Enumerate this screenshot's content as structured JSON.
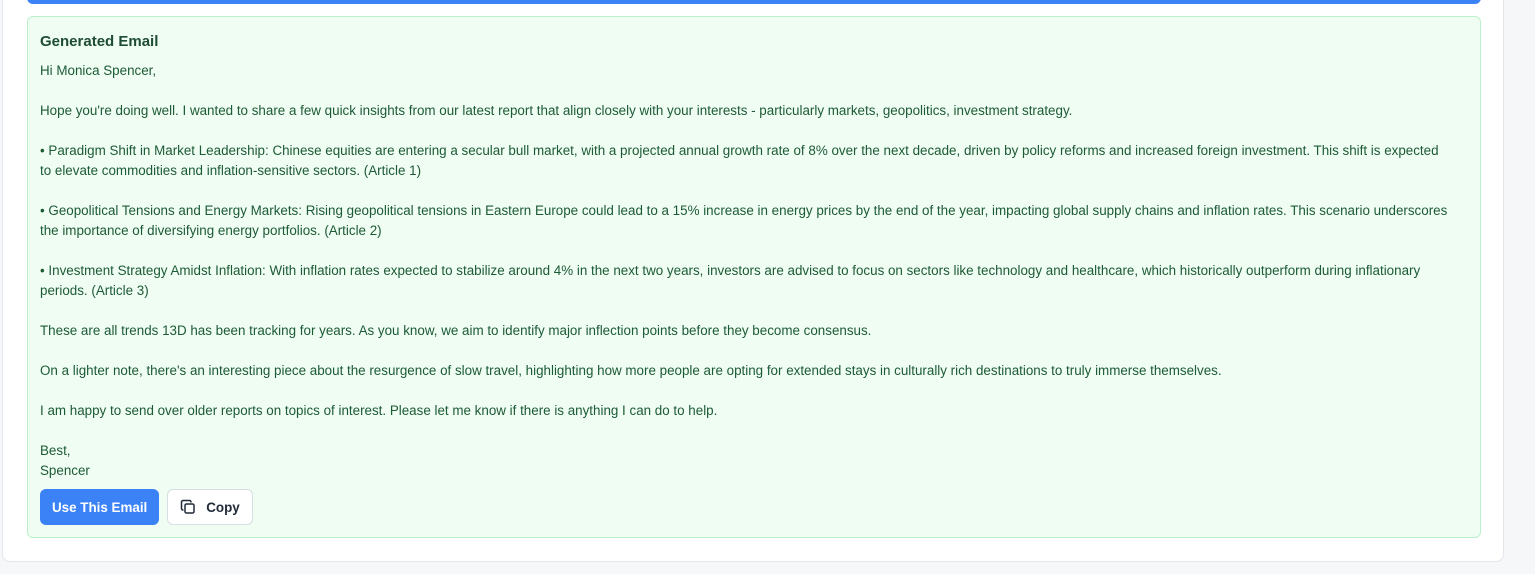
{
  "panel": {
    "title": "Generated Email",
    "paragraphs": [
      "Hi Monica Spencer,",
      "Hope you're doing well. I wanted to share a few quick insights from our latest report that align closely with your interests - particularly markets, geopolitics, investment strategy.",
      "• Paradigm Shift in Market Leadership: Chinese equities are entering a secular bull market, with a projected annual growth rate of 8% over the next decade, driven by policy reforms and increased foreign investment. This shift is expected to elevate commodities and inflation-sensitive sectors. (Article 1)",
      "• Geopolitical Tensions and Energy Markets: Rising geopolitical tensions in Eastern Europe could lead to a 15% increase in energy prices by the end of the year, impacting global supply chains and inflation rates. This scenario underscores the importance of diversifying energy portfolios. (Article 2)",
      "• Investment Strategy Amidst Inflation: With inflation rates expected to stabilize around 4% in the next two years, investors are advised to focus on sectors like technology and healthcare, which historically outperform during inflationary periods. (Article 3)",
      "These are all trends 13D has been tracking for years. As you know, we aim to identify major inflection points before they become consensus.",
      "On a lighter note, there's an interesting piece about the resurgence of slow travel, highlighting how more people are opting for extended stays in culturally rich destinations to truly immerse themselves.",
      "I am happy to send over older reports on topics of interest. Please let me know if there is anything I can do to help.",
      "Best,\nSpencer"
    ]
  },
  "actions": {
    "use_label": "Use This Email",
    "copy_label": "Copy",
    "copy_icon": "copy-icon"
  },
  "colors": {
    "accent": "#3b82f6",
    "panel_bg": "#effdf3",
    "panel_border": "#bbf0cd",
    "text": "#1d5a36"
  }
}
